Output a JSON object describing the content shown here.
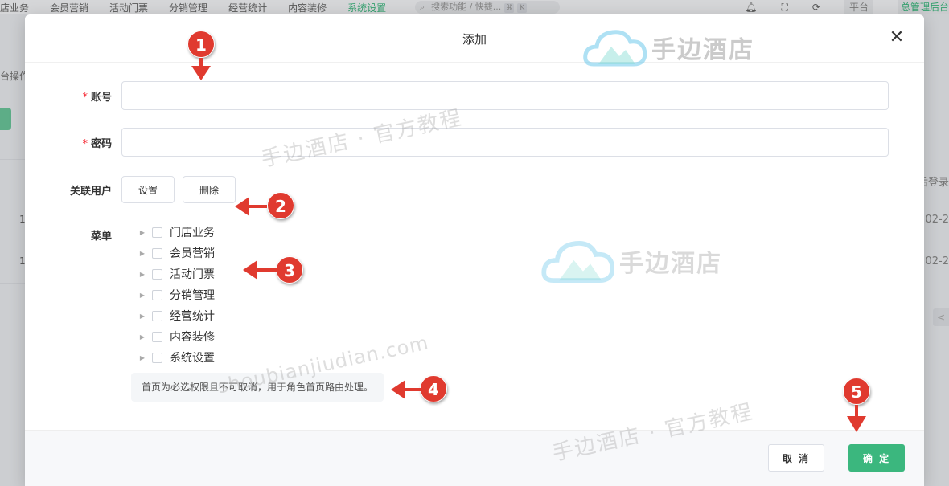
{
  "background": {
    "nav_items": [
      "店业务",
      "会员营销",
      "活动门票",
      "分销管理",
      "经营统计",
      "内容装修",
      "系统设置"
    ],
    "active_nav": "系统设置",
    "search_placeholder": "搜索功能 / 快捷...",
    "search_kbd": [
      "⌘",
      "K"
    ],
    "platform_label": "平台",
    "admin_label": "总管理后台",
    "left_label": "台操作",
    "right_header": "后登录",
    "row_cells_left": [
      "1",
      "1"
    ],
    "row_cells_right": [
      "02-2",
      "02-2"
    ],
    "pager_prev": "<"
  },
  "modal": {
    "title": "添加",
    "close_glyph": "✕",
    "account": {
      "label": "账号",
      "value": "",
      "placeholder": ""
    },
    "password": {
      "label": "密码",
      "value": "",
      "placeholder": ""
    },
    "linked_user": {
      "label": "关联用户",
      "set_button": "设置",
      "delete_button": "删除"
    },
    "menu": {
      "label": "菜单",
      "items": [
        "门店业务",
        "会员营销",
        "活动门票",
        "分销管理",
        "经营统计",
        "内容装修",
        "系统设置"
      ]
    },
    "tip": "首页为必选权限且不可取消，用于角色首页路由处理。",
    "cancel_button": "取 消",
    "ok_button": "确 定"
  },
  "watermarks": {
    "brand": "手边酒店",
    "tutorial": "手边酒店 · 官方教程",
    "domain": "shoubianjiudian.com"
  },
  "annotations": [
    "1",
    "2",
    "3",
    "4",
    "5"
  ],
  "colors": {
    "primary": "#3bb77e",
    "required": "#f5222d",
    "marker": "#e03a2f"
  }
}
